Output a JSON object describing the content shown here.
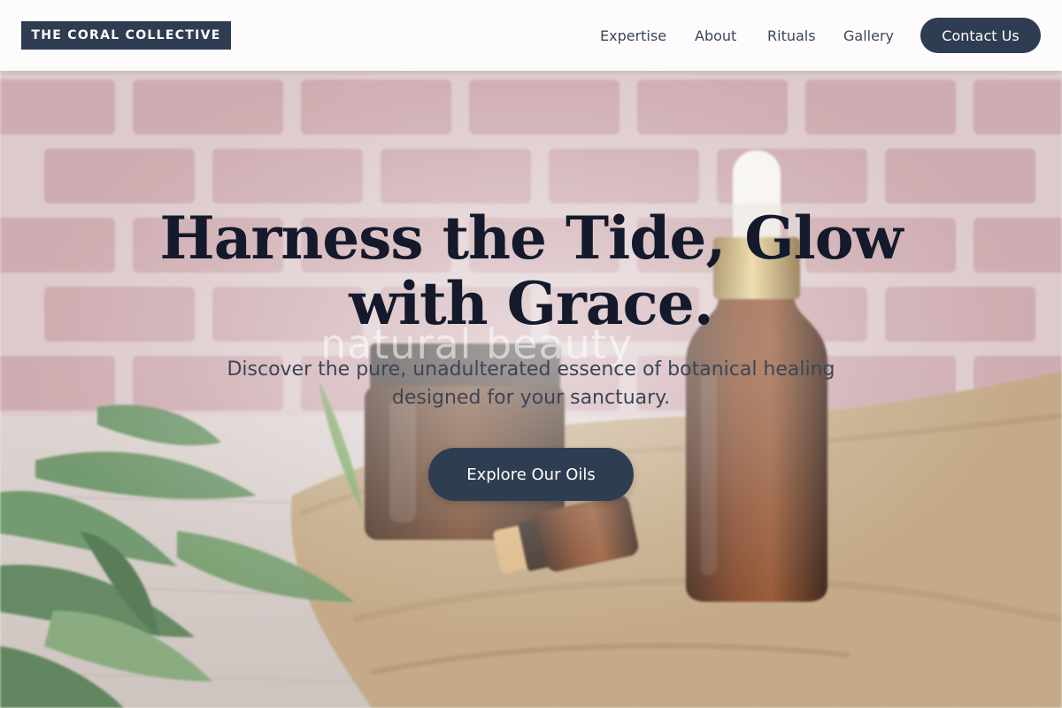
{
  "header": {
    "logo_text": "THE CORAL COLLECTIVE",
    "nav": [
      {
        "label": "Expertise"
      },
      {
        "label": "About"
      },
      {
        "label": "Rituals"
      },
      {
        "label": "Gallery"
      }
    ],
    "contact_label": "Contact Us"
  },
  "hero": {
    "title": "Harness the Tide, Glow with Grace.",
    "subtitle": "Discover the pure, unadulterated essence of botanical healing designed for your sanctuary.",
    "cta_label": "Explore Our Oils",
    "watermark_text": "natural beauty"
  },
  "colors": {
    "primary": "#2f3d52",
    "heading": "#141a2c",
    "body_text": "#3c4556",
    "nav_text": "#3a4658",
    "header_bg": "#ffffff"
  }
}
